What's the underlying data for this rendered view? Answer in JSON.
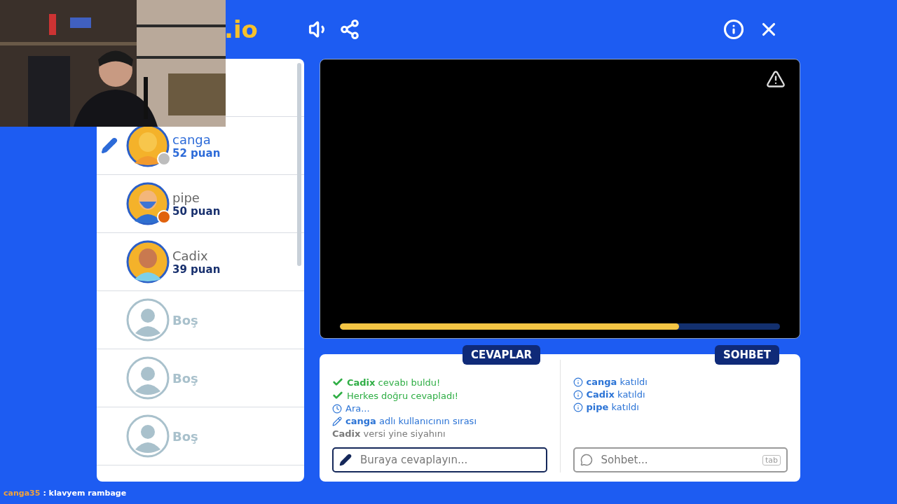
{
  "logo": {
    "text": ".io"
  },
  "toolbar": {
    "left": [
      {
        "kind": "sound"
      },
      {
        "kind": "share"
      }
    ],
    "right": [
      {
        "kind": "info"
      },
      {
        "kind": "close"
      }
    ]
  },
  "players": [
    {
      "kind": "bald",
      "name": "canga",
      "points": "52 puan",
      "drawing": true,
      "color": "#bdbdbd"
    },
    {
      "kind": "bearded",
      "name": "pipe",
      "points": "50 puan",
      "drawing": false,
      "color": "#e0620d"
    },
    {
      "kind": "man",
      "name": "Cadix",
      "points": "39 puan",
      "drawing": false
    },
    {
      "kind": "empty",
      "name": "Boş",
      "drawing": false
    },
    {
      "kind": "empty",
      "name": "Boş",
      "drawing": false
    },
    {
      "kind": "empty",
      "name": "Boş",
      "drawing": false
    }
  ],
  "canvas": {
    "timer": {
      "level": 0.77
    }
  },
  "answers": {
    "tab": "CEVAPLAR",
    "messages": [
      {
        "kind": "check",
        "text": "**Cadix** cevabı buldu!"
      },
      {
        "kind": "check",
        "text": "Herkes doğru cevapladı!"
      },
      {
        "kind": "clock",
        "text": "Ara..."
      },
      {
        "kind": "pencil",
        "text": "**canga** adlı kullanıcının sırası"
      },
      {
        "kind": "plain",
        "text": "**Cadix** versi yine siyahını"
      }
    ],
    "placeholder": "Buraya cevaplayın..."
  },
  "chat": {
    "tab": "SOHBET",
    "messages": [
      {
        "kind": "info",
        "text": "**canga** katıldı"
      },
      {
        "kind": "info",
        "text": "**Cadix** katıldı"
      },
      {
        "kind": "info",
        "text": "**pipe** katıldı"
      }
    ],
    "placeholder": "Sohbet...",
    "key_hint": "tab"
  },
  "stream_chat": {
    "user": "canga35",
    "message": ": klavyem rambage"
  }
}
